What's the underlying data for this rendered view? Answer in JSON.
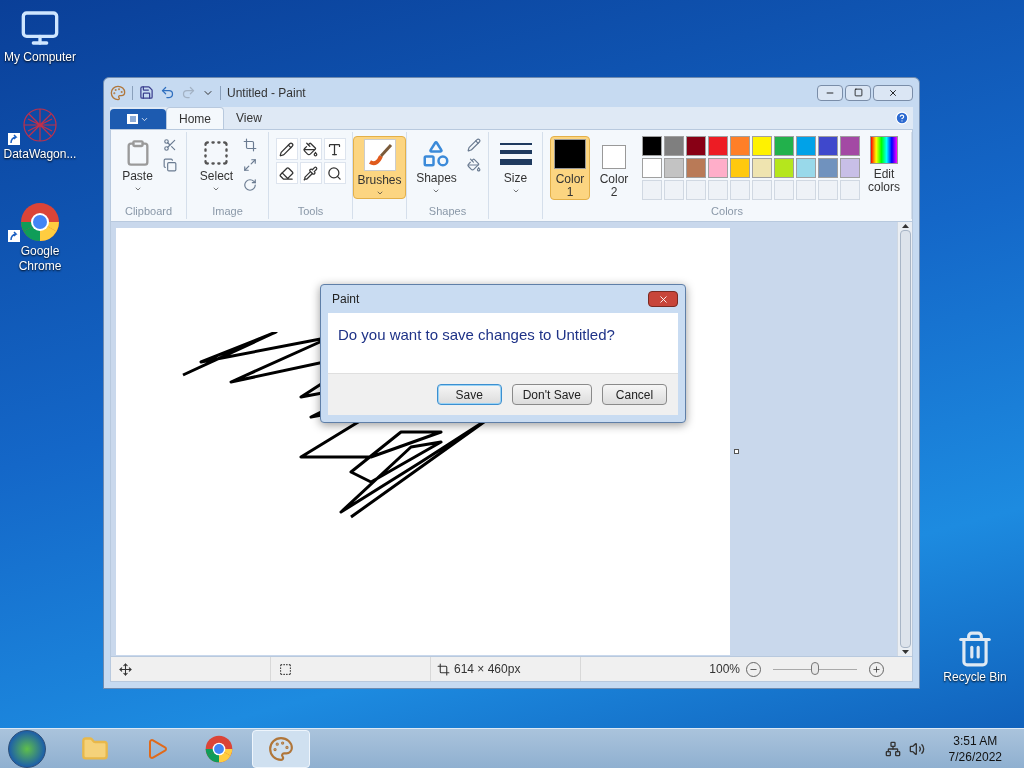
{
  "desktop_icons": [
    {
      "label": "My Computer",
      "kind": "computer",
      "shortcut": false
    },
    {
      "label": "DataWagon...",
      "kind": "network",
      "shortcut": true
    },
    {
      "label": "Google Chrome",
      "kind": "chrome",
      "shortcut": true
    },
    {
      "label": "Recycle Bin",
      "kind": "bin",
      "shortcut": false
    }
  ],
  "window": {
    "title": "Untitled - Paint",
    "tabs": [
      {
        "label": "Home",
        "selected": true
      },
      {
        "label": "View",
        "selected": false
      }
    ],
    "ribbon": {
      "paste": "Paste",
      "select": "Select",
      "brushes": {
        "label": "Brushes",
        "selected": true
      },
      "shapes": "Shapes",
      "size": "Size",
      "color1": {
        "label": "Color",
        "sub": "1",
        "color": "#000000",
        "selected": true
      },
      "color2": {
        "label": "Color",
        "sub": "2",
        "color": "#ffffff",
        "selected": false
      },
      "edit_colors": "Edit colors",
      "groups": [
        "Clipboard",
        "Image",
        "Tools",
        "Shapes",
        "Colors"
      ],
      "palette": [
        {
          "color": "#000000"
        },
        {
          "color": "#7f7f7f"
        },
        {
          "color": "#880015"
        },
        {
          "color": "#ed1c24"
        },
        {
          "color": "#ff7f27"
        },
        {
          "color": "#fff200"
        },
        {
          "color": "#22b14c"
        },
        {
          "color": "#00a2e8"
        },
        {
          "color": "#3f48cc"
        },
        {
          "color": "#a349a4"
        },
        {
          "color": "#ffffff"
        },
        {
          "color": "#c3c3c3"
        },
        {
          "color": "#b97a57"
        },
        {
          "color": "#ffaec9"
        },
        {
          "color": "#ffc90e"
        },
        {
          "color": "#efe4b0"
        },
        {
          "color": "#b5e61d"
        },
        {
          "color": "#99d9ea"
        },
        {
          "color": "#7092be"
        },
        {
          "color": "#c8bfe7"
        }
      ],
      "custom_colors": [
        {
          "filled": false
        },
        {
          "filled": false
        },
        {
          "filled": false
        },
        {
          "filled": false
        },
        {
          "filled": false
        },
        {
          "filled": false
        },
        {
          "filled": false
        },
        {
          "filled": false
        },
        {
          "filled": false
        },
        {
          "filled": false
        }
      ]
    },
    "status_bar": {
      "dimensions": "614 × 460px",
      "zoom": "100%",
      "zoom_slider": {
        "level": 0.5
      }
    }
  },
  "dialog": {
    "title": "Paint",
    "message": "Do you want to save changes to Untitled?",
    "buttons": [
      {
        "label": "Save",
        "default": true
      },
      {
        "label": "Don't Save",
        "default": false
      },
      {
        "label": "Cancel",
        "default": false
      }
    ]
  },
  "taskbar": {
    "items": [
      {
        "kind": "folder",
        "selected": false
      },
      {
        "kind": "media",
        "selected": false
      },
      {
        "kind": "chrome",
        "selected": false
      },
      {
        "kind": "paint",
        "selected": true
      }
    ],
    "time": "3:51 AM",
    "date": "7/26/2022"
  }
}
